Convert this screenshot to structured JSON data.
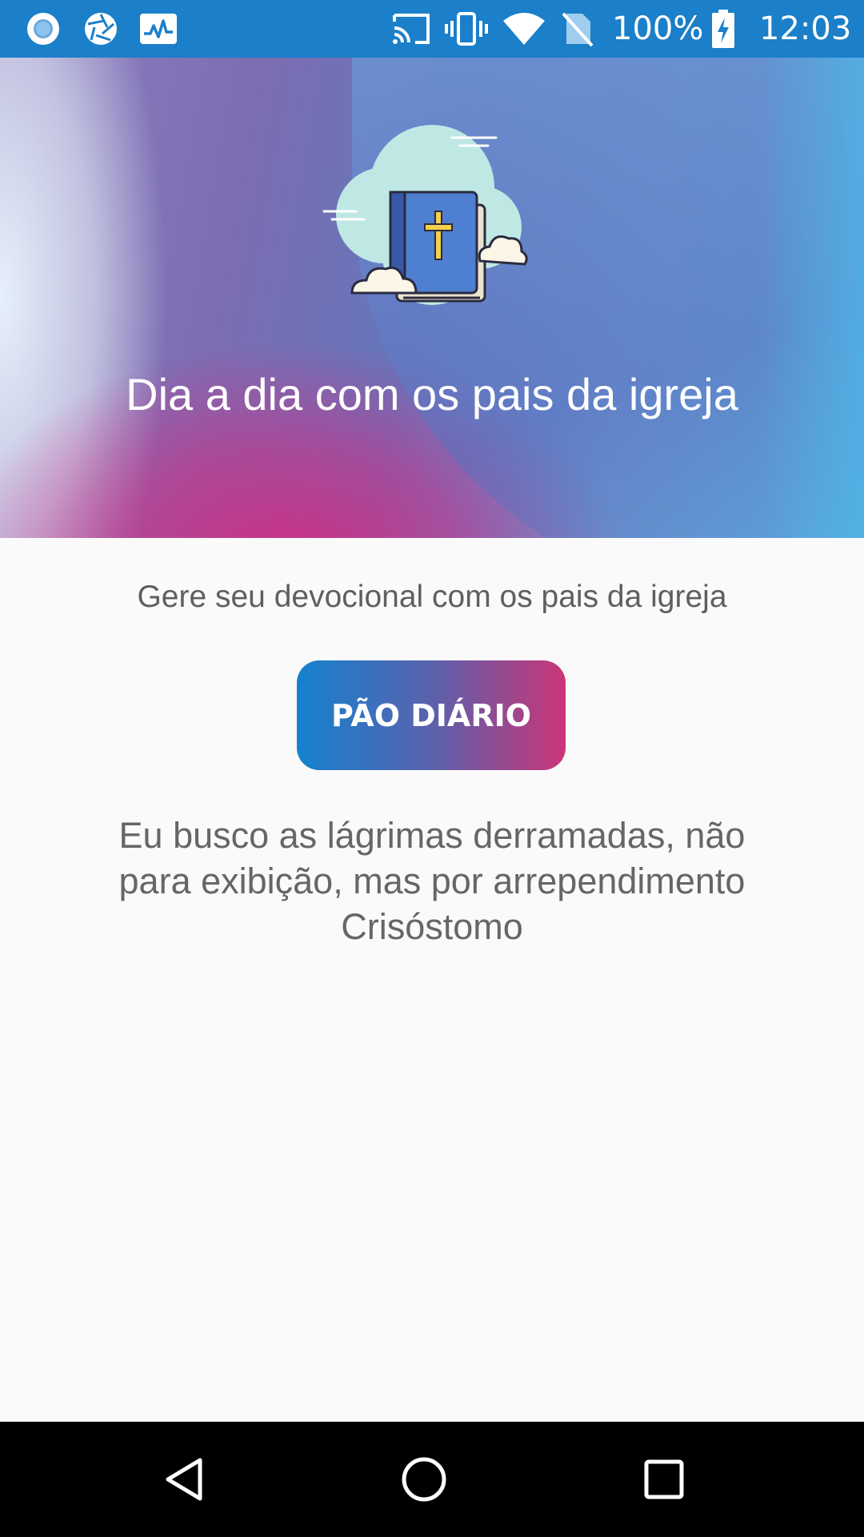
{
  "status_bar": {
    "battery": "100%",
    "time": "12:03",
    "left_icons": [
      "record-icon",
      "shutter-icon",
      "activity-icon"
    ],
    "right_icons": [
      "cast-icon",
      "vibrate-icon",
      "wifi-icon",
      "no-sim-icon",
      "battery-charging-icon"
    ]
  },
  "header": {
    "title": "Dia a dia com os pais da igreja",
    "logo_icon": "bible-cloud-icon"
  },
  "main": {
    "subtitle": "Gere seu devocional com os pais da igreja",
    "button_label": "PÃO DIÁRIO",
    "quote_lines": [
      "Eu busco as lágrimas derramadas, não",
      "para exibição, mas por arrependimento"
    ],
    "quote_author": "Crisóstomo"
  },
  "nav_bar": {
    "icons": [
      "back-icon",
      "home-icon",
      "recents-icon"
    ]
  },
  "colors": {
    "status_bar": "#1b7fc9",
    "button_start": "#1482cf",
    "button_end": "#cb3578",
    "background": "#fafafa"
  }
}
